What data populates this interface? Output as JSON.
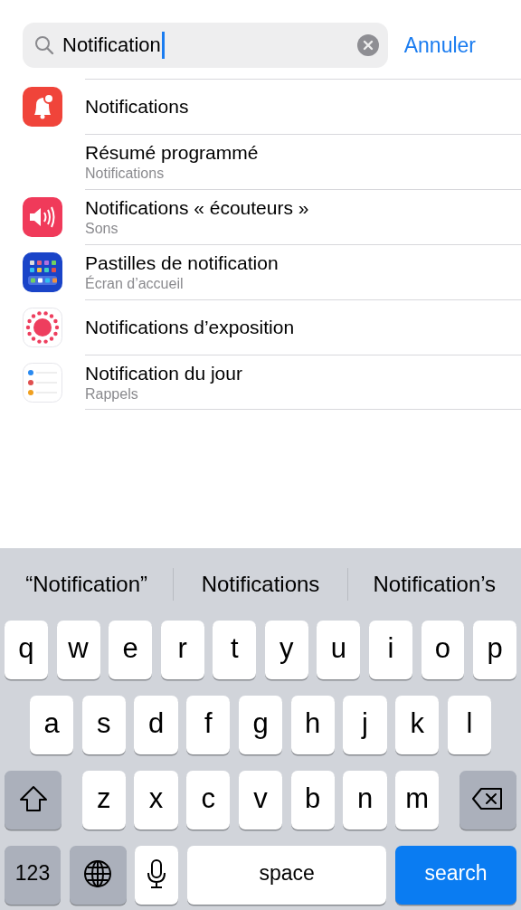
{
  "search": {
    "value": "Notification",
    "cancel": "Annuler"
  },
  "results": [
    {
      "kind": "bell",
      "title": "Notifications"
    },
    {
      "kind": "plain",
      "title": "Résumé programmé",
      "subtitle": "Notifications"
    },
    {
      "kind": "speaker",
      "title": "Notifications « écouteurs »",
      "subtitle": "Sons"
    },
    {
      "kind": "grid",
      "title": "Pastilles de notification",
      "subtitle": "Écran d’accueil"
    },
    {
      "kind": "dots",
      "title": "Notifications d’exposition"
    },
    {
      "kind": "list",
      "title": "Notification du jour",
      "subtitle": "Rappels"
    }
  ],
  "keyboard": {
    "suggestions": [
      "“Notification”",
      "Notifications",
      "Notification’s"
    ],
    "top_row": [
      {
        "kind": "letter",
        "label": "q"
      },
      {
        "kind": "letter",
        "label": "w"
      },
      {
        "kind": "letter",
        "label": "e"
      },
      {
        "kind": "letter",
        "label": "r"
      },
      {
        "kind": "letter",
        "label": "t"
      },
      {
        "kind": "letter",
        "label": "y"
      },
      {
        "kind": "letter",
        "label": "u"
      },
      {
        "kind": "letter",
        "label": "i"
      },
      {
        "kind": "letter",
        "label": "o"
      },
      {
        "kind": "letter",
        "label": "p"
      }
    ],
    "middle_row": [
      {
        "kind": "letter",
        "label": "a"
      },
      {
        "kind": "letter",
        "label": "s"
      },
      {
        "kind": "letter",
        "label": "d"
      },
      {
        "kind": "letter",
        "label": "f"
      },
      {
        "kind": "letter",
        "label": "g"
      },
      {
        "kind": "letter",
        "label": "h"
      },
      {
        "kind": "letter",
        "label": "j"
      },
      {
        "kind": "letter",
        "label": "k"
      },
      {
        "kind": "letter",
        "label": "l"
      }
    ],
    "lower_row": [
      {
        "kind": "shift"
      },
      {
        "kind": "letter",
        "label": "z"
      },
      {
        "kind": "letter",
        "label": "x"
      },
      {
        "kind": "letter",
        "label": "c"
      },
      {
        "kind": "letter",
        "label": "v"
      },
      {
        "kind": "letter",
        "label": "b"
      },
      {
        "kind": "letter",
        "label": "n"
      },
      {
        "kind": "letter",
        "label": "m"
      },
      {
        "kind": "delete"
      }
    ],
    "bottom_row": [
      {
        "kind": "mode",
        "label": "123"
      },
      {
        "kind": "globe"
      },
      {
        "kind": "mic"
      },
      {
        "kind": "space",
        "label": "space"
      },
      {
        "kind": "return",
        "label": "search"
      }
    ]
  }
}
